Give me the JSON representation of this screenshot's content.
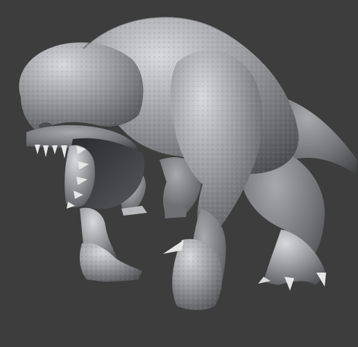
{
  "viewport": {
    "background_color": "#3d3d3d"
  },
  "model": {
    "subject": "creature-sculpt",
    "material": "clay",
    "base_color": "#9a9c9f",
    "highlight_color": "#d7d9dc",
    "shadow_color": "#4b4d51",
    "claw_color": "#e6e6e6"
  }
}
